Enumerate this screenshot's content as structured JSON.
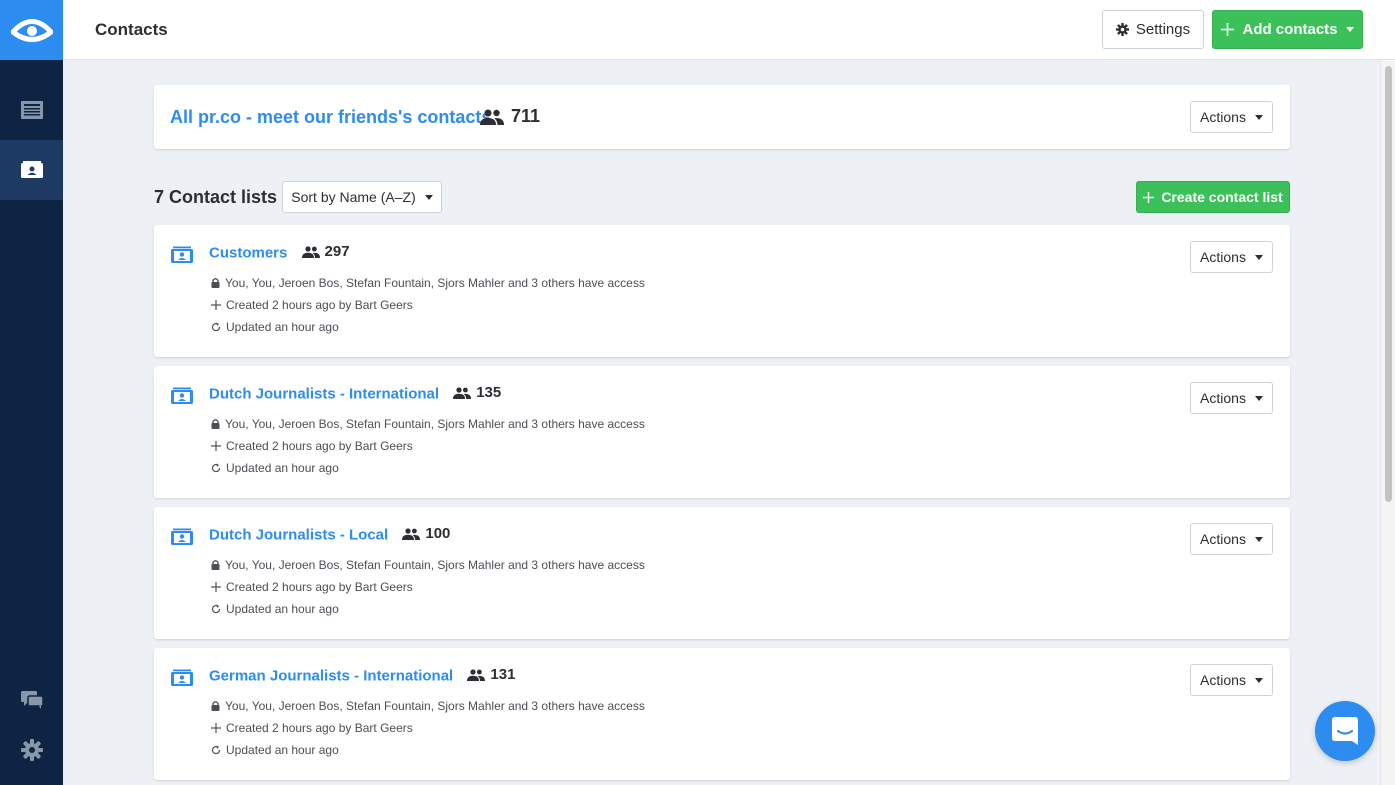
{
  "colors": {
    "brand": "#2d8cf0",
    "sidebar": "#0f2442",
    "success": "#3cc15a"
  },
  "header": {
    "title": "Contacts",
    "settings_label": "Settings",
    "add_label": "Add contacts"
  },
  "all_contacts": {
    "title": "All pr.co - meet our friends's contacts",
    "count": "711",
    "actions_label": "Actions"
  },
  "lists_header": {
    "title": "7 Contact lists",
    "sort_label": "Sort by Name (A–Z)",
    "create_label": "Create contact list"
  },
  "lists": [
    {
      "name": "Customers",
      "count": "297",
      "access": "You, You, Jeroen Bos, Stefan Fountain, Sjors Mahler and 3 others have access",
      "created": "Created 2 hours ago by Bart Geers",
      "updated": "Updated an hour ago",
      "actions_label": "Actions"
    },
    {
      "name": "Dutch Journalists - International",
      "count": "135",
      "access": "You, You, Jeroen Bos, Stefan Fountain, Sjors Mahler and 3 others have access",
      "created": "Created 2 hours ago by Bart Geers",
      "updated": "Updated an hour ago",
      "actions_label": "Actions"
    },
    {
      "name": "Dutch Journalists - Local",
      "count": "100",
      "access": "You, You, Jeroen Bos, Stefan Fountain, Sjors Mahler and 3 others have access",
      "created": "Created 2 hours ago by Bart Geers",
      "updated": "Updated an hour ago",
      "actions_label": "Actions"
    },
    {
      "name": "German Journalists - International",
      "count": "131",
      "access": "You, You, Jeroen Bos, Stefan Fountain, Sjors Mahler and 3 others have access",
      "created": "Created 2 hours ago by Bart Geers",
      "updated": "Updated an hour ago",
      "actions_label": "Actions"
    }
  ],
  "icons": {
    "logo": "eye-logo-icon",
    "nav_news": "newspaper-icon",
    "nav_contacts": "contact-card-icon",
    "chat": "chat-icon",
    "settings": "gear-icon",
    "people": "people-icon",
    "lock": "lock-icon",
    "plus": "plus-icon",
    "refresh": "refresh-icon",
    "messenger": "messenger-icon"
  }
}
